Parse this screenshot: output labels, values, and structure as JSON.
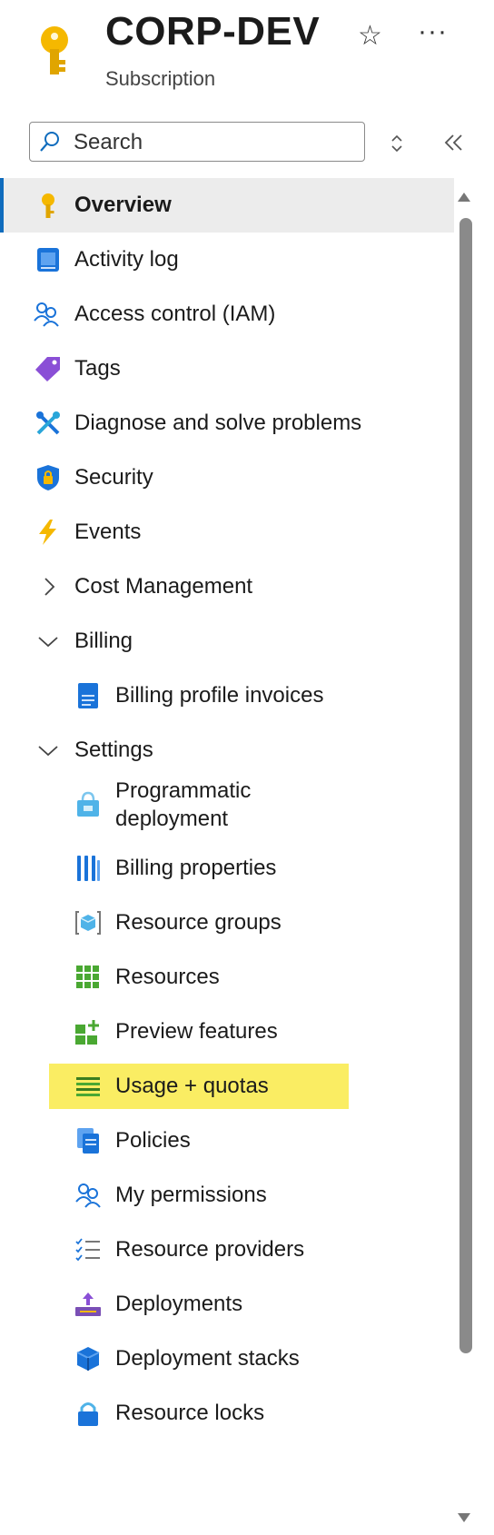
{
  "header": {
    "title": "CORP-DEV",
    "subtitle": "Subscription",
    "star_glyph": "☆",
    "more_glyph": "···"
  },
  "search": {
    "placeholder": "Search"
  },
  "nav": {
    "items": [
      {
        "label": "Overview",
        "icon": "key-icon"
      },
      {
        "label": "Activity log",
        "icon": "activity-log-icon"
      },
      {
        "label": "Access control (IAM)",
        "icon": "people-icon"
      },
      {
        "label": "Tags",
        "icon": "tag-icon"
      },
      {
        "label": "Diagnose and solve problems",
        "icon": "wrench-icon"
      },
      {
        "label": "Security",
        "icon": "shield-icon"
      },
      {
        "label": "Events",
        "icon": "lightning-icon"
      },
      {
        "label": "Cost Management",
        "icon": "chevron-right-icon"
      },
      {
        "label": "Billing",
        "icon": "chevron-down-icon"
      },
      {
        "label": "Billing profile invoices",
        "icon": "invoice-icon"
      },
      {
        "label": "Settings",
        "icon": "chevron-down-icon"
      },
      {
        "label": "Programmatic",
        "label2": "deployment",
        "icon": "bag-icon"
      },
      {
        "label": "Billing properties",
        "icon": "bars-icon"
      },
      {
        "label": "Resource groups",
        "icon": "cube-bracket-icon"
      },
      {
        "label": "Resources",
        "icon": "grid-icon"
      },
      {
        "label": "Preview features",
        "icon": "preview-icon"
      },
      {
        "label": "Usage + quotas",
        "icon": "list-lines-icon"
      },
      {
        "label": "Policies",
        "icon": "policy-icon"
      },
      {
        "label": "My permissions",
        "icon": "person-key-icon"
      },
      {
        "label": "Resource providers",
        "icon": "checklist-icon"
      },
      {
        "label": "Deployments",
        "icon": "upload-icon"
      },
      {
        "label": "Deployment stacks",
        "icon": "cube-icon"
      },
      {
        "label": "Resource locks",
        "icon": "lock-icon"
      }
    ]
  },
  "colors": {
    "accent": "#0f6cbd",
    "selected_bg": "#ececec",
    "highlight": "#faed63",
    "key_gold": "#f5b800"
  }
}
